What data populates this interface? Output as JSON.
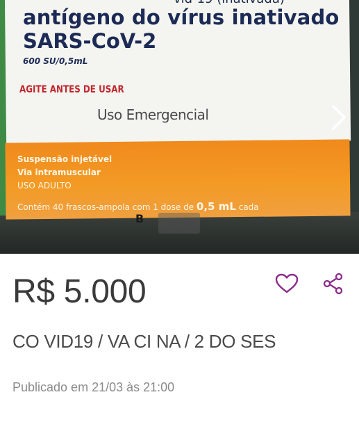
{
  "product_image": {
    "label_top_cut": "vid-19 (inativada)",
    "label_antigen": "antígeno do vírus inativado",
    "label_virus": "SARS-CoV-2",
    "label_dose": "600 SU/0,5mL",
    "label_shake": "AGITE ANTES DE USAR",
    "label_emergency": "Uso Emergencial",
    "label_suspension": "Suspensão injetável",
    "label_route": "Via intramuscular",
    "label_adult": "USO ADULTO",
    "label_contents_prefix": "Contém 40 frascos-ampola com 1 dose de",
    "label_contents_volume": "0,5 mL",
    "label_contents_suffix": "cada",
    "logo_mark": "B"
  },
  "gallery": {
    "next_icon": "chevron-right-icon"
  },
  "listing": {
    "price": "R$ 5.000",
    "title": "CO VID19 / VA CI NA / 2 DO SES",
    "published": "Publicado em 21/03 às 21:00"
  },
  "actions": {
    "favorite_icon": "heart-outline-icon",
    "share_icon": "share-icon"
  },
  "colors": {
    "accent": "#8b2c8b",
    "price_text": "#3a3a3a",
    "muted_text": "#8a8a8a"
  }
}
